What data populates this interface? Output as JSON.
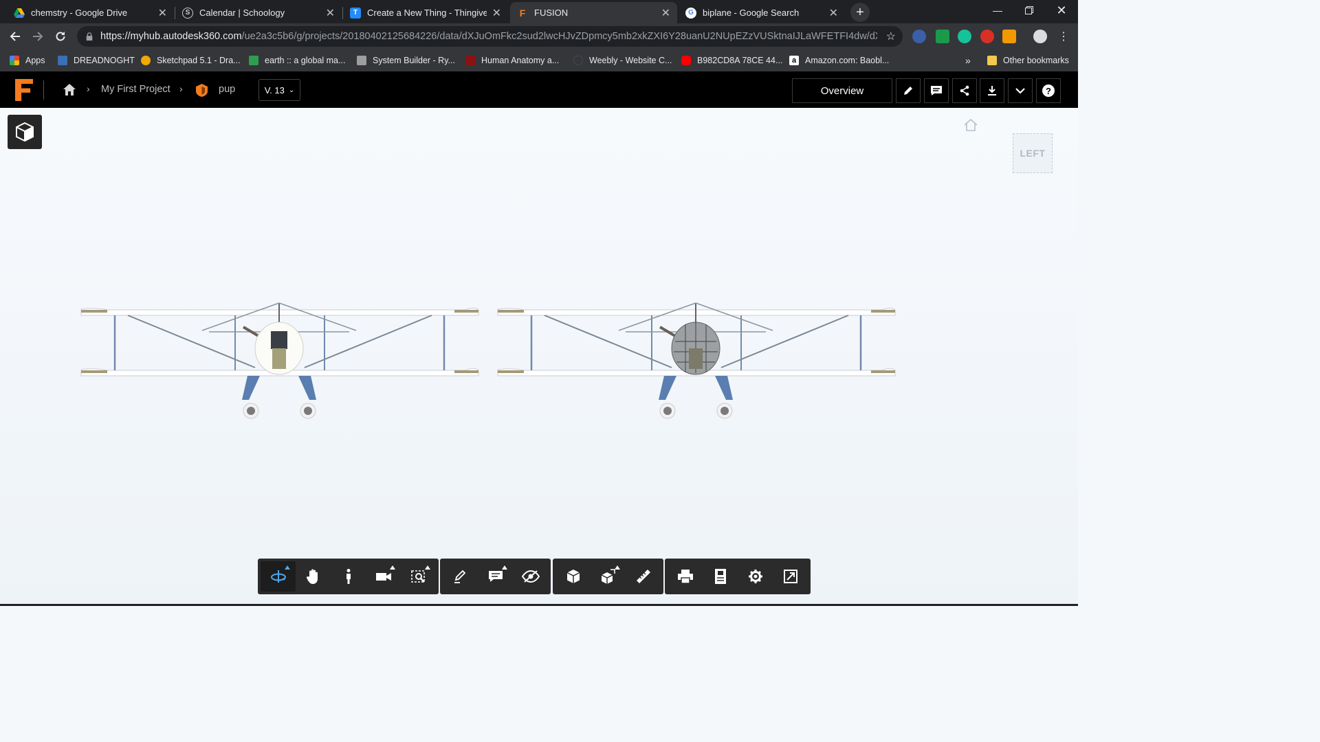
{
  "browser": {
    "tabs": [
      {
        "title": "chemstry - Google Drive",
        "icon": "google-drive-icon",
        "active": false
      },
      {
        "title": "Calendar | Schoology",
        "icon": "schoology-icon",
        "active": false
      },
      {
        "title": "Create a New Thing - Thingiverse",
        "icon": "thingiverse-icon",
        "active": false
      },
      {
        "title": "FUSION",
        "icon": "fusion-icon",
        "active": true
      },
      {
        "title": "biplane - Google Search",
        "icon": "google-icon",
        "active": false
      }
    ],
    "url_host": "https://myhub.autodesk360.com",
    "url_path": "/ue2a3c5b6/g/projects/20180402125684226/data/dXJuOmFkc2sud2lwcHJvZDpmcy5mb2xkZXI6Y28uanU2NUpEZzVUSktnaIJLaWFETFI4dw/dXJu...",
    "bookmarks": [
      {
        "label": "Apps",
        "icon": "apps-grid-icon"
      },
      {
        "label": "DREADNOGHT",
        "icon": "bookmark-icon"
      },
      {
        "label": "Sketchpad 5.1 - Dra...",
        "icon": "sketchpad-icon"
      },
      {
        "label": "earth :: a global ma...",
        "icon": "earth-icon"
      },
      {
        "label": "System Builder - Ry...",
        "icon": "system-builder-icon"
      },
      {
        "label": "Human Anatomy a...",
        "icon": "anatomy-icon"
      },
      {
        "label": "Weebly - Website C...",
        "icon": "weebly-icon"
      },
      {
        "label": "B982CD8A 78CE 44...",
        "icon": "youtube-icon"
      },
      {
        "label": "Amazon.com: Baobl...",
        "icon": "amazon-icon"
      }
    ],
    "bookmarks_overflow": "»",
    "other_bookmarks": "Other bookmarks"
  },
  "app": {
    "breadcrumb": {
      "project": "My First Project",
      "item": "pup"
    },
    "version": "V. 13",
    "overview_label": "Overview",
    "header_buttons": [
      "pencil-icon",
      "comment-icon",
      "share-icon",
      "download-icon",
      "chevron-down-icon",
      "help-icon"
    ],
    "viewcube_label": "LEFT"
  },
  "viewer": {
    "toolbar_groups": [
      [
        {
          "name": "orbit-icon",
          "active": true,
          "flyout": true
        },
        {
          "name": "pan-icon",
          "active": false,
          "flyout": false
        },
        {
          "name": "walk-icon",
          "active": false,
          "flyout": false
        },
        {
          "name": "camera-icon",
          "active": false,
          "flyout": true
        },
        {
          "name": "zoom-window-icon",
          "active": false,
          "flyout": true
        }
      ],
      [
        {
          "name": "markup-icon",
          "active": false,
          "flyout": false
        },
        {
          "name": "comment-icon",
          "active": false,
          "flyout": true
        },
        {
          "name": "hide-icon",
          "active": false,
          "flyout": false
        }
      ],
      [
        {
          "name": "model-browser-icon",
          "active": false,
          "flyout": false
        },
        {
          "name": "explode-icon",
          "active": false,
          "flyout": true
        },
        {
          "name": "measure-icon",
          "active": false,
          "flyout": false
        }
      ],
      [
        {
          "name": "print-icon",
          "active": false,
          "flyout": false
        },
        {
          "name": "properties-icon",
          "active": false,
          "flyout": false
        },
        {
          "name": "settings-icon",
          "active": false,
          "flyout": false
        },
        {
          "name": "fullscreen-icon",
          "active": false,
          "flyout": false
        }
      ]
    ]
  },
  "colors": {
    "tab_bar": "#202124",
    "toolbar": "#35363a",
    "app_header": "#000000",
    "fusion_orange": "#f37c20",
    "active_tool": "#4aa8f0",
    "landing_gear": "#5b7eb0"
  }
}
